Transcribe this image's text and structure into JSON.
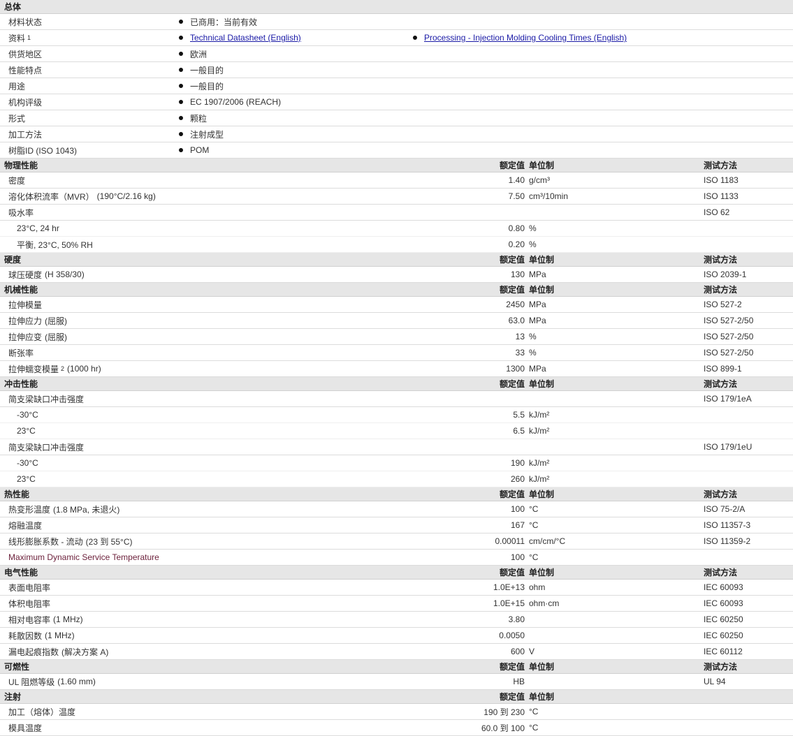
{
  "general": {
    "title": "总体",
    "rows": [
      {
        "label": "材料状态",
        "value": "已商用：当前有效"
      },
      {
        "label": "资料",
        "sup": "1",
        "links": [
          "Technical Datasheet (English)",
          "Processing - Injection Molding Cooling Times (English)"
        ]
      },
      {
        "label": "供货地区",
        "value": "欧洲"
      },
      {
        "label": "性能特点",
        "value": "一般目的"
      },
      {
        "label": "用途",
        "value": "一般目的"
      },
      {
        "label": "机构评级",
        "value": "EC 1907/2006 (REACH)"
      },
      {
        "label": "形式",
        "value": "颗粒"
      },
      {
        "label": "加工方法",
        "value": "注射成型"
      },
      {
        "label": "树脂ID (ISO 1043)",
        "value": "POM"
      }
    ]
  },
  "column_headers": {
    "value": "额定值",
    "unit": "单位制",
    "method": "测试方法"
  },
  "sections": [
    {
      "title": "物理性能",
      "show_headers": true,
      "rows": [
        {
          "name": "密度",
          "value": "1.40",
          "unit": "g/cm³",
          "method": "ISO 1183"
        },
        {
          "name": "溶化体积流率（MVR）",
          "name_cond": "(190°C/2.16 kg)",
          "value": "7.50",
          "unit": "cm³/10min",
          "method": "ISO 1133"
        },
        {
          "name": "吸水率",
          "value": "",
          "unit": "",
          "method": "ISO 62"
        },
        {
          "name": "23°C, 24 hr",
          "sub": true,
          "value": "0.80",
          "unit": "%",
          "method": ""
        },
        {
          "name": "平衡, 23°C, 50% RH",
          "sub": true,
          "value": "0.20",
          "unit": "%",
          "method": ""
        }
      ]
    },
    {
      "title": "硬度",
      "show_headers": true,
      "rows": [
        {
          "name": "球压硬度",
          "name_cond": "(H 358/30)",
          "value": "130",
          "unit": "MPa",
          "method": "ISO 2039-1"
        }
      ]
    },
    {
      "title": "机械性能",
      "show_headers": true,
      "rows": [
        {
          "name": "拉伸模量",
          "value": "2450",
          "unit": "MPa",
          "method": "ISO 527-2"
        },
        {
          "name": "拉伸应力",
          "name_cond": "(屈服)",
          "value": "63.0",
          "unit": "MPa",
          "method": "ISO 527-2/50"
        },
        {
          "name": "拉伸应变",
          "name_cond": "(屈服)",
          "value": "13",
          "unit": "%",
          "method": "ISO 527-2/50"
        },
        {
          "name": "断张率",
          "value": "33",
          "unit": "%",
          "method": "ISO 527-2/50"
        },
        {
          "name": "拉伸蠕变模量",
          "sup": "2",
          "name_cond": "(1000 hr)",
          "value": "1300",
          "unit": "MPa",
          "method": "ISO 899-1"
        }
      ]
    },
    {
      "title": "冲击性能",
      "show_headers": true,
      "rows": [
        {
          "name": "简支梁缺口冲击强度",
          "value": "",
          "unit": "",
          "method": "ISO 179/1eA"
        },
        {
          "name": "-30°C",
          "sub": true,
          "value": "5.5",
          "unit": "kJ/m²",
          "method": ""
        },
        {
          "name": "23°C",
          "sub": true,
          "value": "6.5",
          "unit": "kJ/m²",
          "method": ""
        },
        {
          "name": "简支梁缺口冲击强度",
          "value": "",
          "unit": "",
          "method": "ISO 179/1eU"
        },
        {
          "name": "-30°C",
          "sub": true,
          "value": "190",
          "unit": "kJ/m²",
          "method": ""
        },
        {
          "name": "23°C",
          "sub": true,
          "value": "260",
          "unit": "kJ/m²",
          "method": ""
        }
      ]
    },
    {
      "title": "热性能",
      "show_headers": true,
      "rows": [
        {
          "name": "热变形温度",
          "name_cond": "(1.8 MPa, 未退火)",
          "value": "100",
          "unit": "°C",
          "method": "ISO 75-2/A"
        },
        {
          "name": "熔融温度",
          "value": "167",
          "unit": "°C",
          "method": "ISO 11357-3"
        },
        {
          "name": "线形膨胀系数 - 流动",
          "name_cond": "(23 到 55°C)",
          "value": "0.00011",
          "unit": "cm/cm/°C",
          "method": "ISO 11359-2"
        },
        {
          "name": "Maximum Dynamic Service Temperature",
          "maroon": true,
          "value": "100",
          "unit": "°C",
          "method": ""
        }
      ]
    },
    {
      "title": "电气性能",
      "show_headers": true,
      "rows": [
        {
          "name": "表面电阻率",
          "value": "1.0E+13",
          "unit": "ohm",
          "method": "IEC 60093"
        },
        {
          "name": "体积电阻率",
          "value": "1.0E+15",
          "unit": "ohm·cm",
          "method": "IEC 60093"
        },
        {
          "name": "相对电容率",
          "name_cond": "(1 MHz)",
          "value": "3.80",
          "unit": "",
          "method": "IEC 60250"
        },
        {
          "name": "耗散因数",
          "name_cond": "(1 MHz)",
          "value": "0.0050",
          "unit": "",
          "method": "IEC 60250"
        },
        {
          "name": "漏电起痕指数",
          "name_cond": "(解决方案 A)",
          "value": "600",
          "unit": "V",
          "method": "IEC 60112"
        }
      ]
    },
    {
      "title": "可燃性",
      "show_headers": true,
      "rows": [
        {
          "name": "UL 阻燃等级",
          "name_cond": "(1.60 mm)",
          "value": "HB",
          "unit": "",
          "method": "UL 94"
        }
      ]
    },
    {
      "title": "注射",
      "show_headers": true,
      "hide_method": true,
      "rows": [
        {
          "name": "加工（熔体）温度",
          "value": "190 到  230",
          "unit": "°C",
          "method": ""
        },
        {
          "name": "模具温度",
          "value": "60.0 到  100",
          "unit": "°C",
          "method": ""
        }
      ]
    }
  ]
}
